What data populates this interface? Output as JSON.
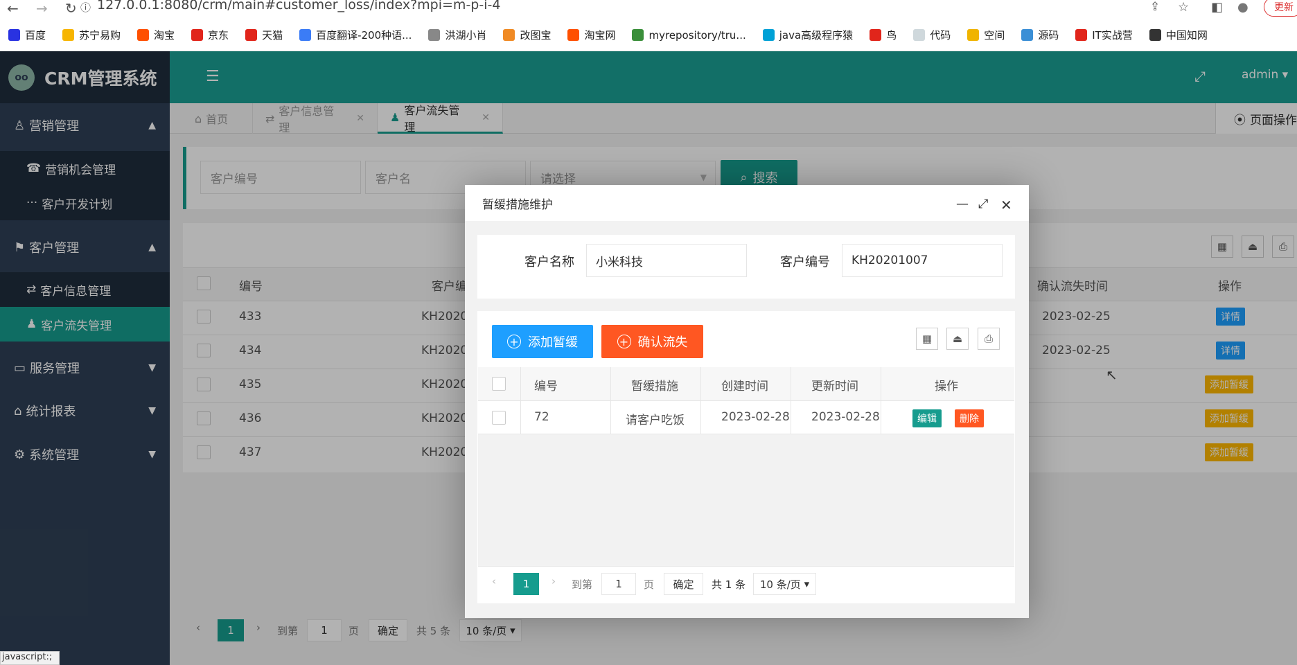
{
  "browser": {
    "url": "127.0.0.1:8080/crm/main#customer_loss/index?mpi=m-p-i-4",
    "update_label": "更新",
    "bookmarks": [
      {
        "label": "百度",
        "color": "#2932e1"
      },
      {
        "label": "苏宁易购",
        "color": "#f7b500"
      },
      {
        "label": "淘宝",
        "color": "#ff5000"
      },
      {
        "label": "京东",
        "color": "#e1251b"
      },
      {
        "label": "天猫",
        "color": "#e1251b"
      },
      {
        "label": "百度翻译-200种语...",
        "color": "#3b7cf6"
      },
      {
        "label": "洪湖小肖",
        "color": "#888888"
      },
      {
        "label": "改图宝",
        "color": "#f08a24"
      },
      {
        "label": "淘宝网",
        "color": "#ff5000"
      },
      {
        "label": "myrepository/tru...",
        "color": "#3a8f3a"
      },
      {
        "label": "java高级程序猿",
        "color": "#00a1d6"
      },
      {
        "label": "鸟",
        "color": "#e1251b"
      },
      {
        "label": "代码",
        "color": "#cfd8dc"
      },
      {
        "label": "空间",
        "color": "#f0b400"
      },
      {
        "label": "源码",
        "color": "#3b8fd6"
      },
      {
        "label": "IT实战营",
        "color": "#e1251b"
      },
      {
        "label": "中国知网",
        "color": "#333333"
      }
    ],
    "status_text": "javascript:;"
  },
  "app": {
    "title": "CRM管理系统",
    "logo_text": "oo",
    "user": "admin"
  },
  "sidebar": {
    "groups": [
      {
        "label": "营销管理",
        "items": [
          "营销机会管理",
          "客户开发计划"
        ]
      },
      {
        "label": "客户管理",
        "items": [
          "客户信息管理",
          "客户流失管理"
        ]
      },
      {
        "label": "服务管理"
      },
      {
        "label": "统计报表"
      },
      {
        "label": "系统管理"
      }
    ]
  },
  "tabs": [
    {
      "label": "首页"
    },
    {
      "label": "客户信息管理"
    },
    {
      "label": "客户流失管理"
    }
  ],
  "page_ops": "页面操作",
  "search": {
    "customer_no_placeholder": "客户编号",
    "customer_name_placeholder": "客户名",
    "select_placeholder": "请选择",
    "button": "搜索"
  },
  "main_table": {
    "headers": [
      "编号",
      "客户编",
      "确认流失时间",
      "操作"
    ],
    "rows": [
      {
        "id": "433",
        "no": "KH2020",
        "time": "2023-02-25",
        "action": "详情",
        "action_color": "#1e9fff"
      },
      {
        "id": "434",
        "no": "KH2020",
        "time": "2023-02-25",
        "action": "详情",
        "action_color": "#1e9fff"
      },
      {
        "id": "435",
        "no": "KH2020",
        "time": "",
        "action": "添加暂缓",
        "action_color": "#ffb800"
      },
      {
        "id": "436",
        "no": "KH2020",
        "time": "",
        "action": "添加暂缓",
        "action_color": "#ffb800"
      },
      {
        "id": "437",
        "no": "KH2020",
        "time": "",
        "action": "添加暂缓",
        "action_color": "#ffb800"
      }
    ]
  },
  "main_pager": {
    "current": "1",
    "goto_label": "到第",
    "goto_value": "1",
    "page_label": "页",
    "confirm": "确定",
    "total": "共 5 条",
    "page_size": "10 条/页"
  },
  "dialog": {
    "title": "暂缓措施维护",
    "customer_name_label": "客户名称",
    "customer_name_value": "小米科技",
    "customer_no_label": "客户编号",
    "customer_no_value": "KH20201007",
    "add_button": "添加暂缓",
    "confirm_loss_button": "确认流失",
    "headers": [
      "编号",
      "暂缓措施",
      "创建时间",
      "更新时间",
      "操作"
    ],
    "rows": [
      {
        "id": "72",
        "measure": "请客户吃饭",
        "created": "2023-02-28",
        "updated": "2023-02-28",
        "edit": "编辑",
        "delete": "删除"
      }
    ],
    "pager": {
      "current": "1",
      "goto_label": "到第",
      "goto_value": "1",
      "page_label": "页",
      "confirm": "确定",
      "total": "共 1 条",
      "page_size": "10 条/页"
    }
  },
  "colors": {
    "accent": "#169c8e",
    "header": "#1aa094",
    "sidebar": "#2f4056",
    "blue": "#1e9fff",
    "orange": "#ff5722",
    "warn": "#ffb800"
  }
}
